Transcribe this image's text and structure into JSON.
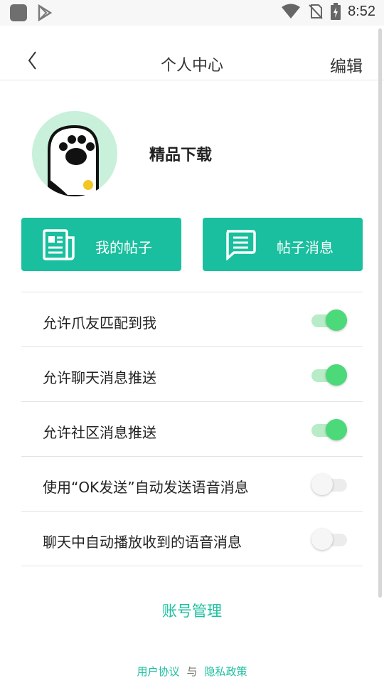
{
  "statusbar": {
    "time": "8:52"
  },
  "header": {
    "title": "个人中心",
    "edit_label": "编辑"
  },
  "profile": {
    "name": "精品下载"
  },
  "actions": [
    {
      "label": "我的帖子",
      "icon": "newspaper-icon"
    },
    {
      "label": "帖子消息",
      "icon": "message-icon"
    }
  ],
  "settings": [
    {
      "label": "允许爪友匹配到我",
      "enabled": true
    },
    {
      "label": "允许聊天消息推送",
      "enabled": true
    },
    {
      "label": "允许社区消息推送",
      "enabled": true
    },
    {
      "label": "使用“OK发送”自动发送语音消息",
      "enabled": false
    },
    {
      "label": "聊天中自动播放收到的语音消息",
      "enabled": false
    }
  ],
  "account_label": "账号管理",
  "footer": {
    "user_agreement": "用户协议",
    "separator": "与",
    "privacy_policy": "隐私政策"
  },
  "colors": {
    "accent": "#19bf9e",
    "toggle_on": "#4cd97a"
  }
}
